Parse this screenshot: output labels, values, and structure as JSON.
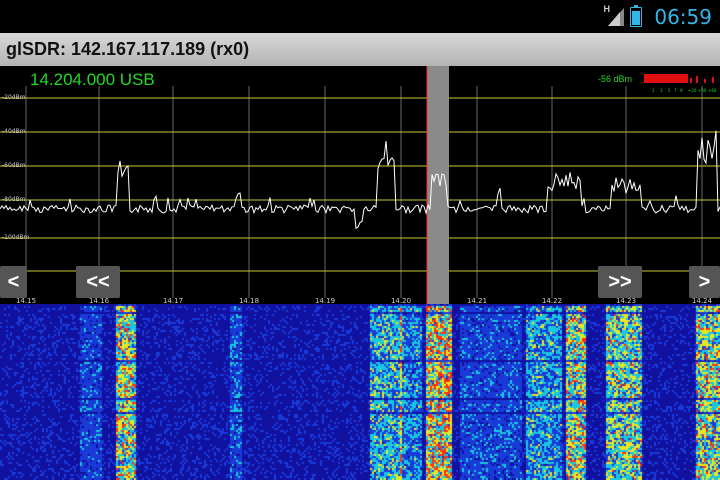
{
  "status_bar": {
    "time": "06:59",
    "network_type": "H",
    "icons": [
      "signal-icon",
      "battery-icon"
    ]
  },
  "titlebar": {
    "title": "glSDR: 142.167.117.189 (rx0)"
  },
  "spectrum": {
    "frequency_display": "14.204.000 USB",
    "signal_level": "-56 dBm",
    "smeter_scale": [
      "1",
      "3",
      "5",
      "7",
      "9",
      "+20",
      "+40",
      "+60"
    ],
    "db_labels": [
      "-20dBm",
      "-40dBm",
      "-60dBm",
      "-80dBm",
      "-100dBm"
    ],
    "freq_ticks": [
      "14.15",
      "14.16",
      "14.17",
      "14.18",
      "14.19",
      "14.20",
      "14.21",
      "14.22",
      "14.23",
      "14.24"
    ],
    "buttons": {
      "left": "<",
      "fast_left": "<<",
      "fast_right": ">>",
      "right": ">"
    },
    "colors": {
      "frequency_text": "#22d822",
      "grid": "#c8c832",
      "trace": "#ffffff",
      "passband": "#8a8a8a",
      "tuning_line": "#ff3030"
    }
  },
  "waterfall": {
    "colors": {
      "background": "#1111a0",
      "low": "#1a3ad8",
      "mid": "#18c8e0",
      "high": "#e8e820",
      "peak": "#ff3010"
    }
  }
}
